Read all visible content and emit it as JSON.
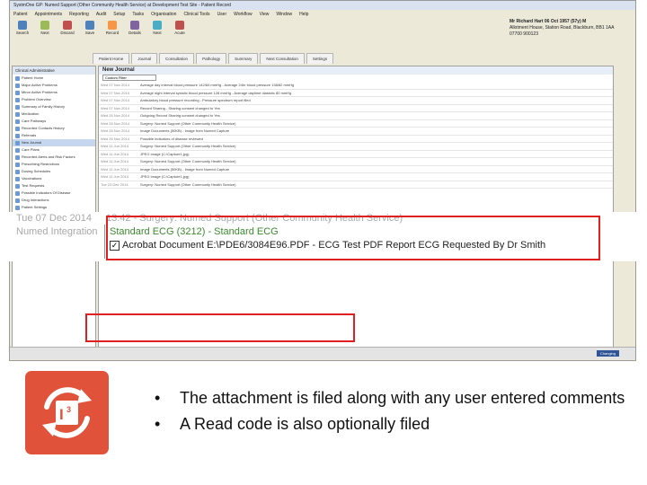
{
  "app": {
    "title": "SystmOne GP: Numed Support (Other Community Health Service) at Development Test Site - Patient Record",
    "menu": [
      "Patient",
      "Appointments",
      "Reporting",
      "Audit",
      "Setup",
      "Tasks",
      "Organisation",
      "Clinical Tools",
      "User",
      "Workflow",
      "View",
      "Window",
      "Help"
    ]
  },
  "toolbar": [
    {
      "label": "Search",
      "color": "#4f81bd"
    },
    {
      "label": "Next",
      "color": "#9bbb59"
    },
    {
      "label": "Discard",
      "color": "#c0504d"
    },
    {
      "label": "Save",
      "color": "#4f81bd"
    },
    {
      "label": "Record",
      "color": "#f79646"
    },
    {
      "label": "Details",
      "color": "#8064a2"
    },
    {
      "label": "Next",
      "color": "#4bacc6"
    },
    {
      "label": "Acute",
      "color": "#c0504d"
    }
  ],
  "patient": {
    "name": "Mr Richard Hart 06 Oct 1957 (57y) M",
    "address": "Allotment House, Station Road, Blackburn, BB1 1AA",
    "phone": "07700 900123"
  },
  "tabs": [
    "Patient Home",
    "Journal",
    "Consultation",
    "Pathology",
    "Summary",
    "Next Consultation",
    "Settings"
  ],
  "sidebar": {
    "header": "Clinical  Administrative",
    "items": [
      "Patient Home",
      "Major Active Problems",
      "Minor Active Problems",
      "Problem Overview",
      "Summary of Family History",
      "Medication",
      "Care Pathways",
      "Recorded Contacts History",
      "Referrals",
      "New Journal",
      "Care Plans",
      "Recorded Alerts and Risk Factors",
      "Prescribing Restrictions",
      "Dosing Schedules",
      "Vaccinations",
      "Test Requests",
      "Possible Indicators Of Disease",
      "Drug Interactions",
      "Patient Settings",
      "Communication",
      "Related Documents",
      "Minor Illness",
      "Referrals",
      "Allergies & Sensitivities",
      "Medication",
      "Practice Team"
    ],
    "selected_index": 9
  },
  "journal": {
    "title": "New Journal",
    "filter_value": "Custom Filter",
    "entries": [
      {
        "date": "Wed 07 Nov 2014",
        "text": "Average day interval blood pressure 142/84 mmHg - Average 24hr blood pressure 138/82 mmHg"
      },
      {
        "date": "Wed 07 Nov 2014",
        "text": "Average night interval systolic blood pressure 128 mmHg - Average daytime diastolic 80 mmHg"
      },
      {
        "date": "Wed 07 Nov 2014",
        "text": "Ambulatory blood pressure recording - Pressure spectrum report filed"
      },
      {
        "date": "Wed 07 Nov 2014",
        "text": "Record Sharing - Sharing consent changed to Yes"
      },
      {
        "date": "Wed 26 Nov 2014",
        "text": "Outgoing Record Sharing consent changed to Yes"
      },
      {
        "date": "Wed 26 Nov 2014",
        "text": "Surgery: Numed Support (Other Community Health Service)"
      },
      {
        "date": "Wed 26 Nov 2014",
        "text": "Image Documents (50KB) - Image from Numed Capture"
      },
      {
        "date": "Wed 26 Nov 2014",
        "text": "Possible indicators of disease reviewed"
      },
      {
        "date": "Wed 11 Jun 2014",
        "text": "Surgery: Numed Support (Other Community Health Service)"
      },
      {
        "date": "Wed 11 Jun 2014",
        "text": "JPEG Image (C:\\Capture1.jpg)"
      },
      {
        "date": "Wed 11 Jun 2014",
        "text": "Surgery: Numed Support (Other Community Health Service)"
      },
      {
        "date": "Wed 11 Jun 2014",
        "text": "Image Documents (50KB) - Image from Numed Capture"
      },
      {
        "date": "Wed 11 Jun 2014",
        "text": "JPEG Image (C:\\Capture1.jpg)"
      },
      {
        "date": "Tue 23 Dec 2014",
        "text": "Surgery: Numed Support (Other Community Health Service)"
      }
    ]
  },
  "zoomed_entry": {
    "date_line": "Tue 07 Dec 2014",
    "time_line": "13:42 - Surgery: Numed Support (Other Community Health Service)",
    "origin": "Numed Integration",
    "read_code": "Standard ECG (3212) - Standard ECG",
    "document": "Acrobat Document E:\\PDE6/3084E96.PDF - ECG Test PDF Report ECG Requested By Dr Smith"
  },
  "status": {
    "changing_label": "Changing"
  },
  "slide": {
    "bullets": [
      "The attachment is filed along with any user entered comments",
      "A Read code is also optionally filed"
    ],
    "logo_color": "#e0533a",
    "highlight_color": "#e02020"
  }
}
